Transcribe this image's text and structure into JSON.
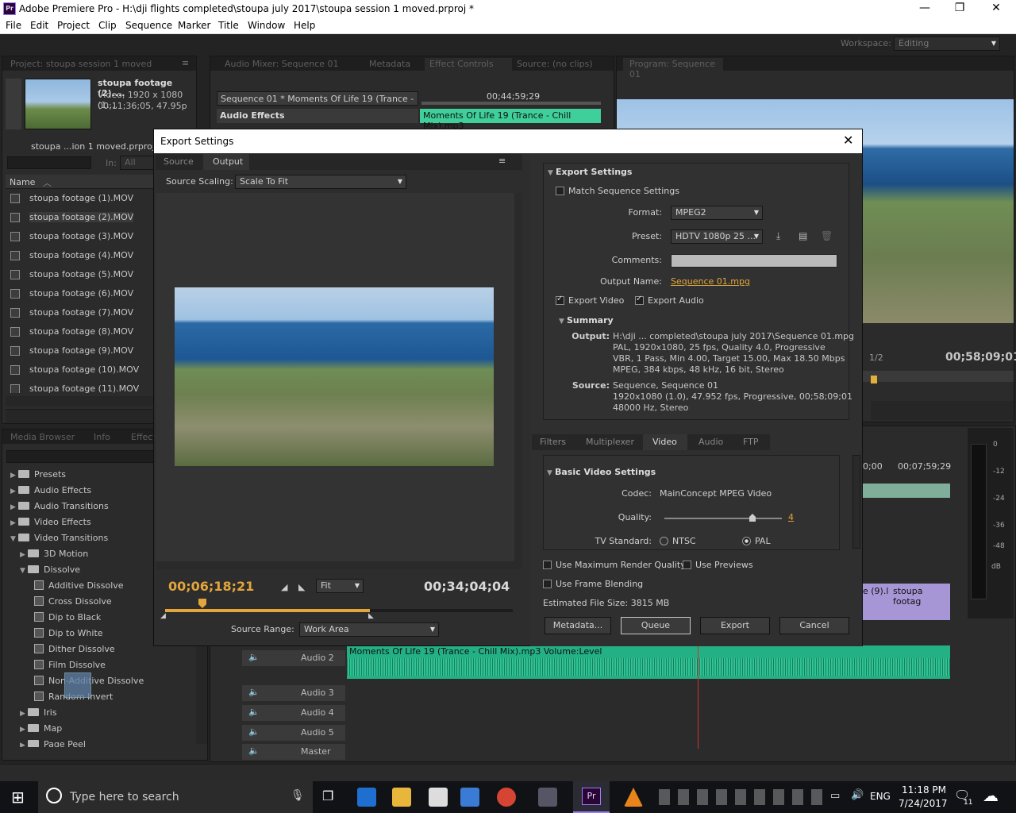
{
  "app": {
    "title": "Adobe Premiere Pro - H:\\dji flights completed\\stoupa july 2017\\stoupa session 1 moved.prproj *",
    "icon": "Pr",
    "menus": [
      "File",
      "Edit",
      "Project",
      "Clip",
      "Sequence",
      "Marker",
      "Title",
      "Window",
      "Help"
    ],
    "workspace_label": "Workspace:",
    "workspace_value": "Editing"
  },
  "project": {
    "tab": "Project: stoupa session 1 moved",
    "clip_name": "stoupa footage (2)....",
    "clip_info1": "Video, 1920 x 1080 (1....",
    "clip_info2": "00;11;36;05, 47.95p",
    "project_file": "stoupa ...ion 1 moved.prproj",
    "in_label": "In:",
    "in_value": "All",
    "col_name": "Name",
    "items": [
      "stoupa footage (1).MOV",
      "stoupa footage (2).MOV",
      "stoupa footage (3).MOV",
      "stoupa footage (4).MOV",
      "stoupa footage (5).MOV",
      "stoupa footage (6).MOV",
      "stoupa footage (7).MOV",
      "stoupa footage (8).MOV",
      "stoupa footage (9).MOV",
      "stoupa footage (10).MOV",
      "stoupa footage (11).MOV"
    ]
  },
  "effects_panel": {
    "tabs": [
      "Media Browser",
      "Info",
      "Effect"
    ],
    "tree": [
      {
        "label": "Presets",
        "indent": 0,
        "kind": "folder",
        "open": false
      },
      {
        "label": "Audio Effects",
        "indent": 0,
        "kind": "folder",
        "open": false
      },
      {
        "label": "Audio Transitions",
        "indent": 0,
        "kind": "folder",
        "open": false
      },
      {
        "label": "Video Effects",
        "indent": 0,
        "kind": "folder",
        "open": false
      },
      {
        "label": "Video Transitions",
        "indent": 0,
        "kind": "folder",
        "open": true
      },
      {
        "label": "3D Motion",
        "indent": 1,
        "kind": "folder",
        "open": false
      },
      {
        "label": "Dissolve",
        "indent": 1,
        "kind": "folder",
        "open": true
      },
      {
        "label": "Additive Dissolve",
        "indent": 2,
        "kind": "trans"
      },
      {
        "label": "Cross Dissolve",
        "indent": 2,
        "kind": "trans"
      },
      {
        "label": "Dip to Black",
        "indent": 2,
        "kind": "trans"
      },
      {
        "label": "Dip to White",
        "indent": 2,
        "kind": "trans"
      },
      {
        "label": "Dither Dissolve",
        "indent": 2,
        "kind": "trans"
      },
      {
        "label": "Film Dissolve",
        "indent": 2,
        "kind": "trans"
      },
      {
        "label": "Non-Additive Dissolve",
        "indent": 2,
        "kind": "trans"
      },
      {
        "label": "Random Invert",
        "indent": 2,
        "kind": "trans"
      },
      {
        "label": "Iris",
        "indent": 1,
        "kind": "folder",
        "open": false
      },
      {
        "label": "Map",
        "indent": 1,
        "kind": "folder",
        "open": false
      },
      {
        "label": "Page Peel",
        "indent": 1,
        "kind": "folder",
        "open": false
      }
    ]
  },
  "top_tabs": {
    "audio_mixer": "Audio Mixer: Sequence 01",
    "metadata": "Metadata",
    "effect_controls": "Effect Controls",
    "source": "Source: (no clips)",
    "seq_label": "Sequence 01 * Moments Of Life 19 (Trance - ...",
    "ec_time": "00;44;59;29",
    "audio_effects": "Audio Effects",
    "audio_clip": "Moments Of Life 19 (Trance - Chill Mix).mp3"
  },
  "program": {
    "tab": "Program: Sequence 01",
    "timecode": "00;58;09;01",
    "zoom": "1/2"
  },
  "timeline": {
    "time1": "0;00",
    "time2": "00;07;59;29",
    "clip1": "e (9).l",
    "clip2": "stoupa footag",
    "audio_clip_label": "Moments Of Life 19 (Trance - Chill Mix).mp3  Volume:Level",
    "tracks": [
      "Audio 2",
      "Audio 3",
      "Audio 4",
      "Audio 5",
      "Master"
    ],
    "meter_labels": [
      "0",
      "-12",
      "-24",
      "-36",
      "-48",
      "dB"
    ]
  },
  "dialog": {
    "title": "Export Settings",
    "tabs": [
      "Source",
      "Output"
    ],
    "source_scaling_label": "Source Scaling:",
    "source_scaling_value": "Scale To Fit",
    "timecode_in": "00;06;18;21",
    "timecode_out": "00;34;04;04",
    "fit_value": "Fit",
    "source_range_label": "Source Range:",
    "source_range_value": "Work Area",
    "export_settings_header": "Export Settings",
    "match_sequence": "Match Sequence Settings",
    "format_label": "Format:",
    "format_value": "MPEG2",
    "preset_label": "Preset:",
    "preset_value": "HDTV 1080p 25 ...",
    "comments_label": "Comments:",
    "output_name_label": "Output Name:",
    "output_name_value": "Sequence 01.mpg",
    "export_video": "Export Video",
    "export_audio": "Export Audio",
    "summary_header": "Summary",
    "output_label": "Output:",
    "output_lines": [
      "H:\\dji ... completed\\stoupa july 2017\\Sequence 01.mpg",
      "PAL, 1920x1080, 25 fps, Quality 4.0, Progressive",
      "VBR, 1 Pass, Min 4.00, Target 15.00, Max 18.50 Mbps",
      "MPEG, 384 kbps, 48 kHz, 16 bit, Stereo"
    ],
    "source_label": "Source:",
    "source_lines": [
      "Sequence, Sequence 01",
      "1920x1080 (1.0), 47.952 fps, Progressive, 00;58;09;01",
      "48000 Hz, Stereo"
    ],
    "settings_tabs": [
      "Filters",
      "Multiplexer",
      "Video",
      "Audio",
      "FTP"
    ],
    "basic_video_header": "Basic Video Settings",
    "codec_label": "Codec:",
    "codec_value": "MainConcept MPEG Video",
    "quality_label": "Quality:",
    "quality_value": "4",
    "quality_fraction": 0.75,
    "tv_standard_label": "TV Standard:",
    "ntsc": "NTSC",
    "pal": "PAL",
    "use_max_quality": "Use Maximum Render Quality",
    "use_previews": "Use Previews",
    "use_frame_blending": "Use Frame Blending",
    "estimated_file_size": "Estimated File Size:  3815 MB",
    "btn_metadata": "Metadata...",
    "btn_queue": "Queue",
    "btn_export": "Export",
    "btn_cancel": "Cancel"
  },
  "taskbar": {
    "search_placeholder": "Type here to search",
    "lang": "ENG",
    "time": "11:18 PM",
    "date": "7/24/2017",
    "notif_count": "11"
  }
}
